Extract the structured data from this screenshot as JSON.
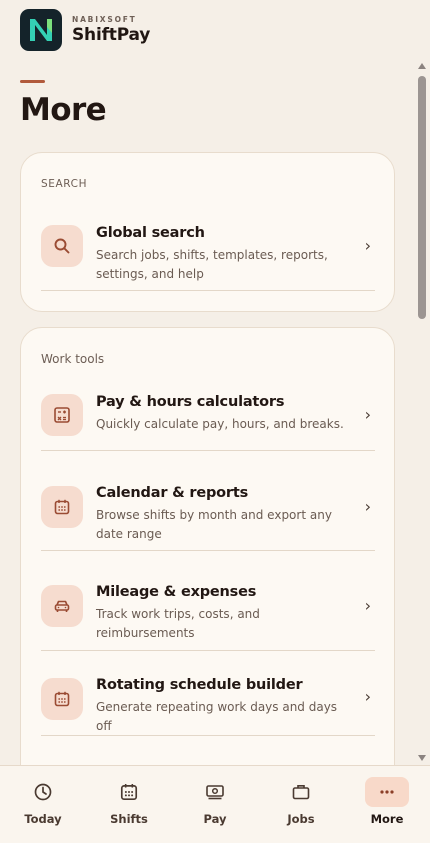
{
  "brand": {
    "company": "NABIXSOFT",
    "app_name": "ShiftPay",
    "logo_letter": "N",
    "colors": {
      "logo_bg": "#14232a",
      "logo_teal": "#34d0b4",
      "logo_green": "#7be07d"
    }
  },
  "page": {
    "title": "More"
  },
  "search_section": {
    "heading": "SEARCH",
    "items": [
      {
        "icon": "search-icon",
        "title": "Global search",
        "subtitle": "Search jobs, shifts, templates, reports, settings, and help"
      }
    ]
  },
  "tools_section": {
    "heading": "Work tools",
    "items": [
      {
        "icon": "calculator-icon",
        "title": "Pay & hours calculators",
        "subtitle": "Quickly calculate pay, hours, and breaks."
      },
      {
        "icon": "calendar-icon",
        "title": "Calendar & reports",
        "subtitle": "Browse shifts by month and export any date range"
      },
      {
        "icon": "car-icon",
        "title": "Mileage & expenses",
        "subtitle": "Track work trips, costs, and reimbursements"
      },
      {
        "icon": "calendar-icon",
        "title": "Rotating schedule builder",
        "subtitle": "Generate repeating work days and days off"
      }
    ]
  },
  "tabbar": {
    "tabs": [
      {
        "icon": "clock-icon",
        "label": "Today",
        "active": false
      },
      {
        "icon": "calendar-icon",
        "label": "Shifts",
        "active": false
      },
      {
        "icon": "money-icon",
        "label": "Pay",
        "active": false
      },
      {
        "icon": "briefcase-icon",
        "label": "Jobs",
        "active": false
      },
      {
        "icon": "more-dots-icon",
        "label": "More",
        "active": true
      }
    ]
  },
  "colors": {
    "background": "#f5efe7",
    "card": "#fdf9f3",
    "accent": "#b15a3c",
    "icon_tile": "#f6dccf",
    "icon_stroke": "#9a4b33",
    "active_tab_bg": "#f8d9c9"
  }
}
